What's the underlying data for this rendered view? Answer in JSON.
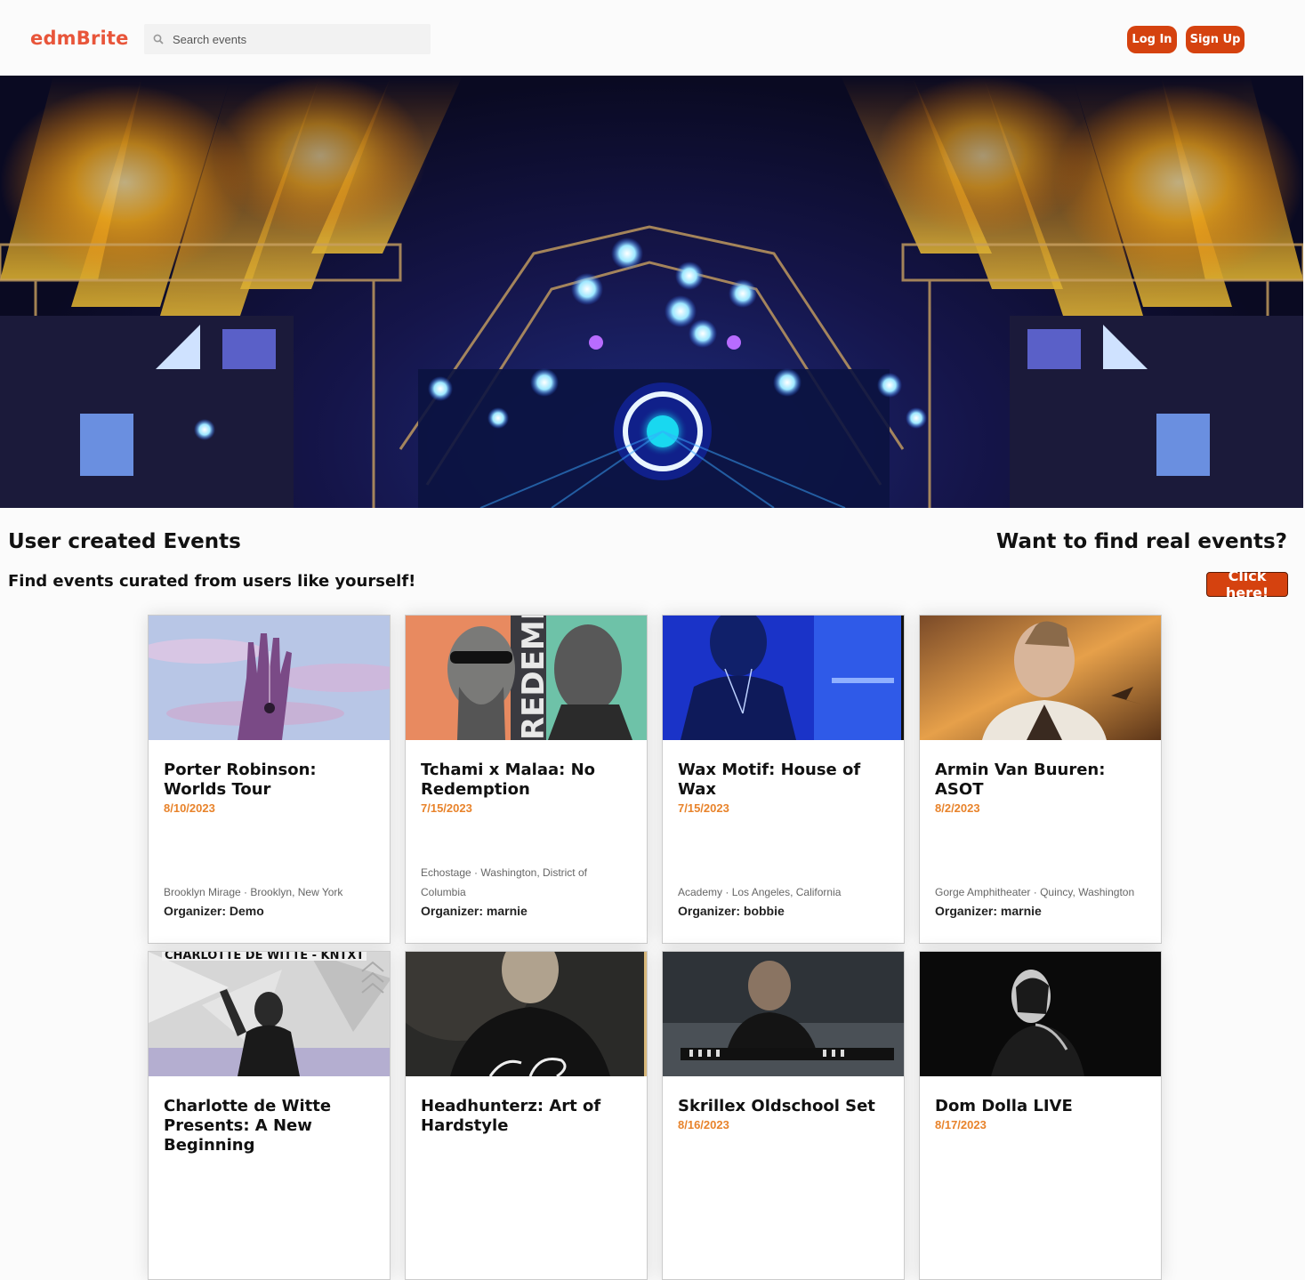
{
  "header": {
    "logo": "edmBrite",
    "search_placeholder": "Search events",
    "login_label": "Log In",
    "signup_label": "Sign Up"
  },
  "section": {
    "title": "User created Events",
    "subtitle": "Find events curated from users like yourself!",
    "real_title": "Want to find real events?",
    "real_button": "Click here!"
  },
  "events": [
    {
      "title": "Porter Robinson: Worlds Tour",
      "date": "8/10/2023",
      "venue": "Brooklyn Mirage",
      "city": "Brooklyn, New York",
      "organizer": "Organizer: Demo"
    },
    {
      "title": "Tchami x Malaa: No Redemption",
      "date": "7/15/2023",
      "venue": "Echostage",
      "city": "Washington, District of Columbia",
      "organizer": "Organizer: marnie"
    },
    {
      "title": "Wax Motif: House of Wax",
      "date": "7/15/2023",
      "venue": "Academy",
      "city": "Los Angeles, California",
      "organizer": "Organizer: bobbie"
    },
    {
      "title": "Armin Van Buuren: ASOT",
      "date": "8/2/2023",
      "venue": "Gorge Amphitheater",
      "city": "Quincy, Washington",
      "organizer": "Organizer: marnie"
    },
    {
      "title": "Charlotte de Witte Presents: A New Beginning",
      "date": "",
      "venue": "",
      "city": "",
      "organizer": "",
      "image_text": "CHARLOTTE DE WITTE - KNTXT"
    },
    {
      "title": "Headhunterz: Art of Hardstyle",
      "date": "",
      "venue": "",
      "city": "",
      "organizer": ""
    },
    {
      "title": "Skrillex Oldschool Set",
      "date": "8/16/2023",
      "venue": "",
      "city": "",
      "organizer": ""
    },
    {
      "title": "Dom Dolla LIVE",
      "date": "8/17/2023",
      "venue": "",
      "city": "",
      "organizer": ""
    }
  ],
  "card_image_text": {
    "redempt": "REDEMPT"
  },
  "colors": {
    "brand": "#e8553a",
    "button": "#d5420f",
    "date": "#e8832b"
  },
  "icons": {
    "search": "search-icon"
  }
}
